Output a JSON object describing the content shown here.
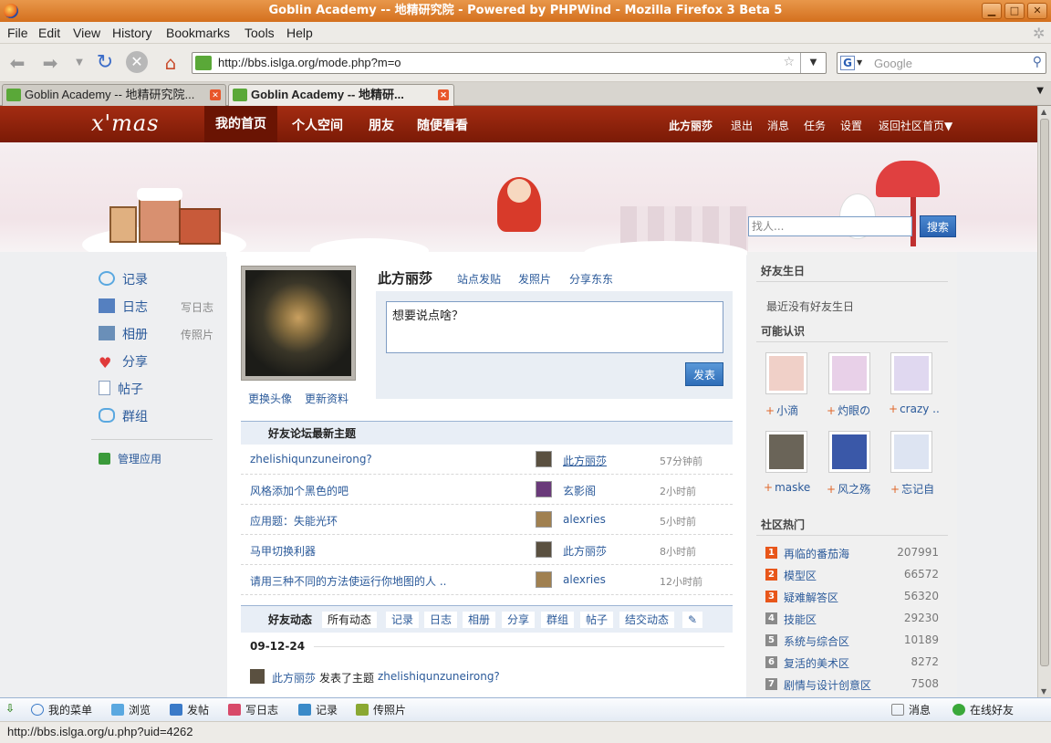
{
  "window": {
    "title": "Goblin Academy -- 地精研究院 - Powered by PHPWind - Mozilla Firefox 3 Beta 5",
    "min": "▁",
    "max": "□",
    "close": "✕"
  },
  "menu": [
    "File",
    "Edit",
    "View",
    "History",
    "Bookmarks",
    "Tools",
    "Help"
  ],
  "nav": {
    "url": "http://bbs.islga.org/mode.php?m=o",
    "search_placeholder": "Google",
    "search_engine": "G"
  },
  "tabs": [
    {
      "label": "Goblin Academy -- 地精研究院..."
    },
    {
      "label": "Goblin Academy -- 地精研..."
    }
  ],
  "site": {
    "logo": "x'mas",
    "nav": [
      "我的首页",
      "个人空间",
      "朋友",
      "随便看看"
    ],
    "user": "此方丽莎",
    "right_links": [
      "退出",
      "消息",
      "任务",
      "设置",
      "返回社区首页▼"
    ],
    "find_placeholder": "找人...",
    "find_button": "搜索"
  },
  "sidebar": {
    "items": [
      {
        "label": "记录",
        "sub": "",
        "icon": "speech-bubble-icon",
        "color": "#5aa8e0"
      },
      {
        "label": "日志",
        "sub": "写日志",
        "icon": "notebook-icon",
        "color": "#5580c0"
      },
      {
        "label": "相册",
        "sub": "传照片",
        "icon": "photo-album-icon",
        "color": "#6a8fb8"
      },
      {
        "label": "分享",
        "sub": "",
        "icon": "heart-icon",
        "color": "#e03a3a"
      },
      {
        "label": "帖子",
        "sub": "",
        "icon": "document-icon",
        "color": "#8aa0c0"
      },
      {
        "label": "群组",
        "sub": "",
        "icon": "chat-group-icon",
        "color": "#5aa8e0"
      }
    ],
    "manage": "管理应用"
  },
  "profile": {
    "name": "此方丽莎",
    "links": [
      "站点发贴",
      "发照片",
      "分享东东"
    ],
    "avatar_links": [
      "更换头像",
      "更新资料"
    ],
    "post_placeholder": "想要说点啥？",
    "post_button": "发表"
  },
  "forum": {
    "title": "好友论坛最新主题",
    "rows": [
      {
        "title": "zhelishiqunzuneirong?",
        "user": "此方丽莎",
        "time": "57分钟前"
      },
      {
        "title": "风格添加个黑色的吧",
        "user": "玄影阁",
        "time": "2小时前"
      },
      {
        "title": "应用题：失能光环",
        "user": "alexries",
        "time": "5小时前"
      },
      {
        "title": "马甲切换利器",
        "user": "此方丽莎",
        "time": "8小时前"
      },
      {
        "title": "请用三种不同的方法使运行你地图的人 ..",
        "user": "alexries",
        "time": "12小时前"
      }
    ]
  },
  "feed": {
    "title": "好友动态",
    "tabs": [
      "所有动态",
      "记录",
      "日志",
      "相册",
      "分享",
      "群组",
      "帖子",
      "结交动态"
    ],
    "date": "09-12-24",
    "entry_user": "此方丽莎",
    "entry_action": "发表了主题",
    "entry_topic": "zhelishiqunzuneirong?"
  },
  "right": {
    "birthday_title": "好友生日",
    "birthday_text": "最近没有好友生日",
    "maybe_title": "可能认识",
    "people": [
      {
        "name": "小滴",
        "color": "#f0d0c8"
      },
      {
        "name": "灼眼の",
        "color": "#e8d0e8"
      },
      {
        "name": "crazy ..",
        "color": "#e0d8f0"
      },
      {
        "name": "maske",
        "color": "#6a6458"
      },
      {
        "name": "风之殇",
        "color": "#3a58a8"
      },
      {
        "name": "忘记自",
        "color": "#dde4f2"
      }
    ],
    "hot_title": "社区热门",
    "hot": [
      {
        "rank": "1",
        "name": "再临的番茄海",
        "count": "207991"
      },
      {
        "rank": "2",
        "name": "模型区",
        "count": "66572"
      },
      {
        "rank": "3",
        "name": "疑难解答区",
        "count": "56320"
      },
      {
        "rank": "4",
        "name": "技能区",
        "count": "29230"
      },
      {
        "rank": "5",
        "name": "系统与综合区",
        "count": "10189"
      },
      {
        "rank": "6",
        "name": "复活的美术区",
        "count": "8272"
      },
      {
        "rank": "7",
        "name": "剧情与设计创意区",
        "count": "7508"
      }
    ]
  },
  "bottom": {
    "left": [
      "我的菜单",
      "浏览",
      "发帖",
      "写日志",
      "记录",
      "传照片"
    ],
    "right": [
      "消息",
      "在线好友"
    ]
  },
  "status": "http://bbs.islga.org/u.php?uid=4262"
}
